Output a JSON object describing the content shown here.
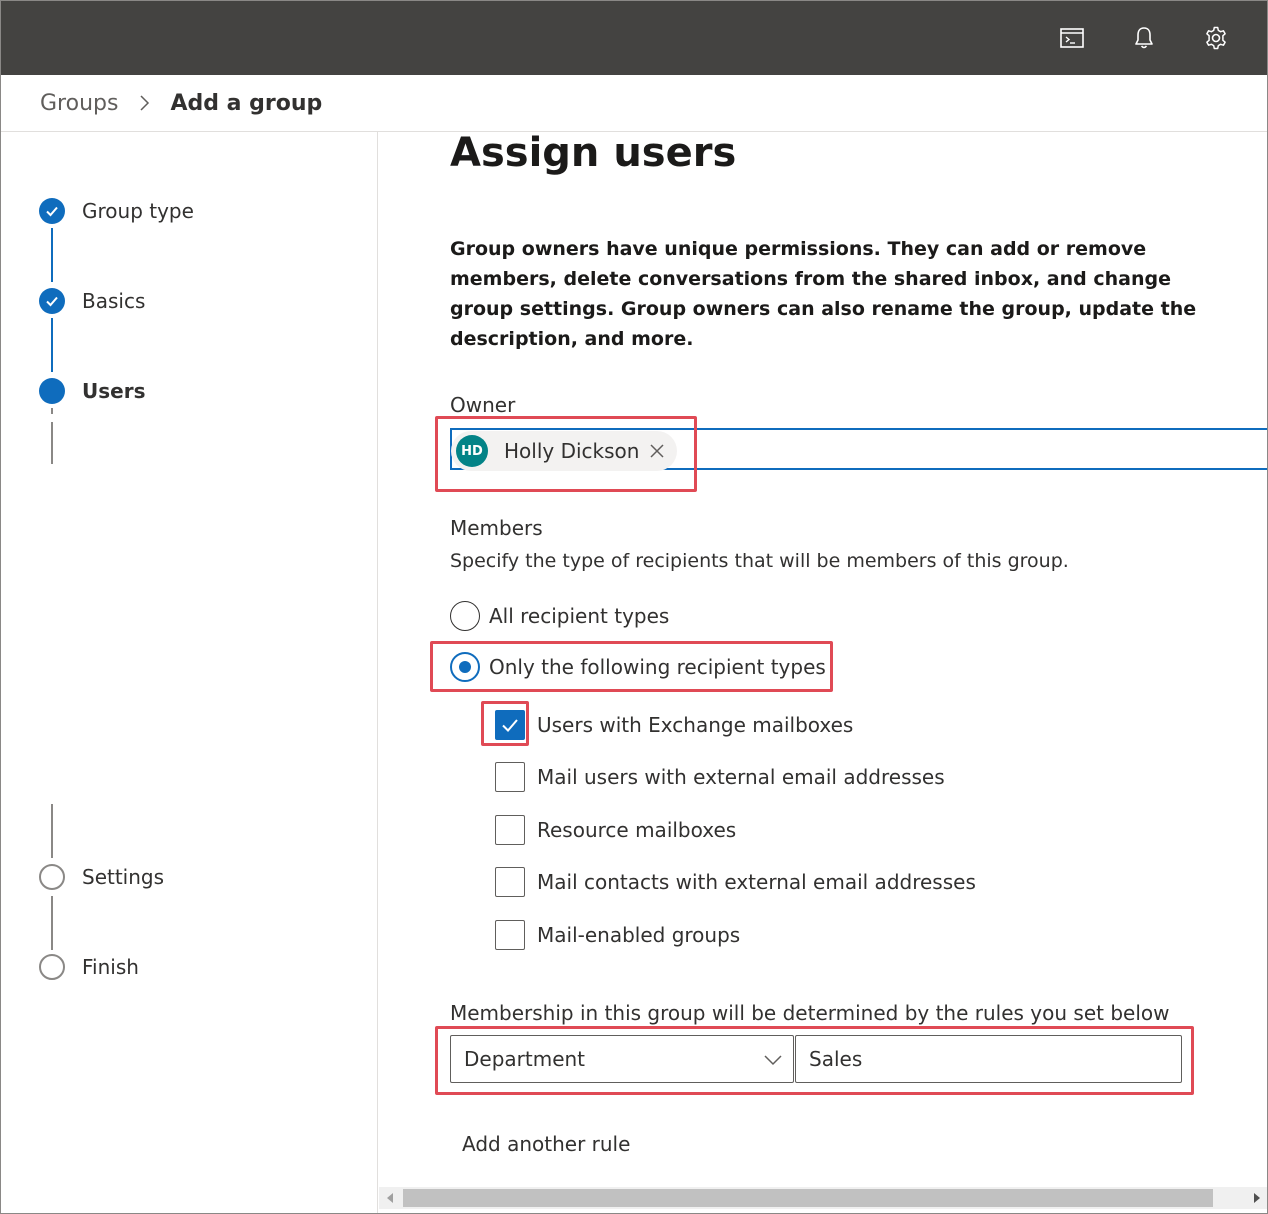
{
  "topbar": {
    "icons": [
      "terminal-icon",
      "bell-icon",
      "gear-icon"
    ]
  },
  "breadcrumb": {
    "parent": "Groups",
    "current": "Add a group"
  },
  "steps": [
    {
      "label": "Group type",
      "state": "completed"
    },
    {
      "label": "Basics",
      "state": "completed"
    },
    {
      "label": "Users",
      "state": "current"
    },
    {
      "label": "Settings",
      "state": "pending"
    },
    {
      "label": "Finish",
      "state": "pending"
    }
  ],
  "main": {
    "title": "Assign users",
    "description": "Group owners have unique permissions. They can add or remove members, delete conversations from the shared inbox, and change group settings. Group owners can also rename the group, update the description, and more.",
    "owner": {
      "label": "Owner",
      "initials": "HD",
      "name": "Holly Dickson"
    },
    "members": {
      "label": "Members",
      "help": "Specify the type of recipients that will be members of this group.",
      "radios": [
        {
          "label": "All recipient types",
          "checked": false
        },
        {
          "label": "Only the following recipient types",
          "checked": true
        }
      ],
      "checkboxes": [
        {
          "label": "Users with Exchange mailboxes",
          "checked": true
        },
        {
          "label": "Mail users with external email addresses",
          "checked": false
        },
        {
          "label": "Resource mailboxes",
          "checked": false
        },
        {
          "label": "Mail contacts with external email addresses",
          "checked": false
        },
        {
          "label": "Mail-enabled groups",
          "checked": false
        }
      ]
    },
    "rules": {
      "label": "Membership in this group will be determined by the rules you set below",
      "attribute": "Department",
      "value": "Sales",
      "add_rule": "Add another rule"
    }
  },
  "colors": {
    "accent": "#0f6cbd",
    "topbar": "#444341",
    "highlight": "#e04a55",
    "avatar": "#038387"
  }
}
